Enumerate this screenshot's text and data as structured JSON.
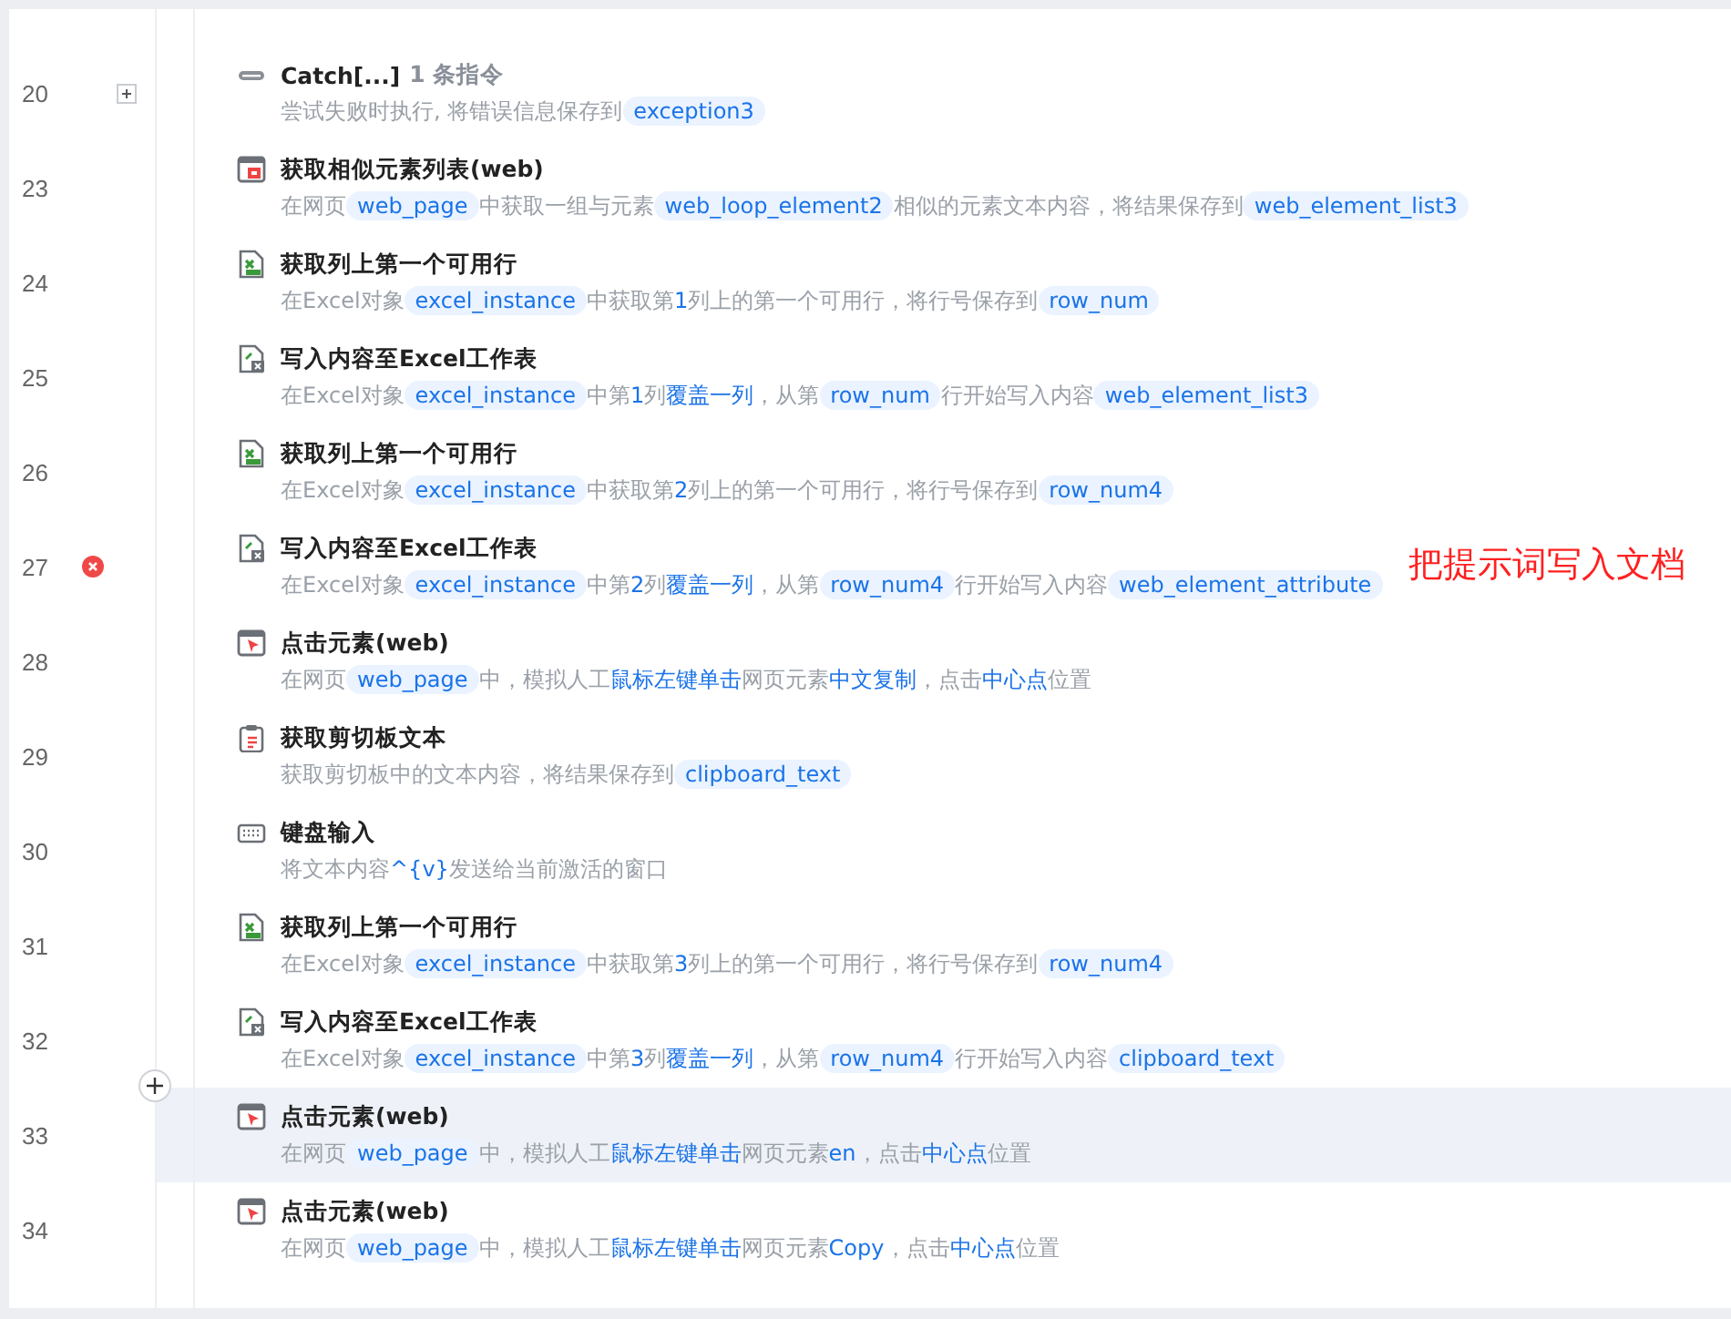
{
  "steps": [
    {
      "line": "20",
      "kind": "catch",
      "collapsed": true,
      "error": false,
      "highlighted": false,
      "title": "Catch[...]",
      "count": "1 条指令",
      "desc": [
        {
          "kind": "text",
          "text": "尝试失败时执行, 将错误信息保存到"
        },
        {
          "kind": "var",
          "text": "exception3"
        }
      ]
    },
    {
      "line": "23",
      "kind": "web-list",
      "error": false,
      "highlighted": false,
      "title": "获取相似元素列表(web)",
      "desc": [
        {
          "kind": "text",
          "text": "在网页"
        },
        {
          "kind": "var",
          "text": "web_page"
        },
        {
          "kind": "text",
          "text": "中获取一组与元素"
        },
        {
          "kind": "var",
          "text": "web_loop_element2"
        },
        {
          "kind": "text",
          "text": "相似的元素文本内容，将结果保存到"
        },
        {
          "kind": "var",
          "text": "web_element_list3"
        }
      ]
    },
    {
      "line": "24",
      "kind": "excel-read",
      "error": false,
      "highlighted": false,
      "title": "获取列上第一个可用行",
      "desc": [
        {
          "kind": "text",
          "text": "在Excel对象"
        },
        {
          "kind": "var",
          "text": "excel_instance"
        },
        {
          "kind": "text",
          "text": "中获取第"
        },
        {
          "kind": "kw",
          "text": "1"
        },
        {
          "kind": "text",
          "text": "列上的第一个可用行，将行号保存到"
        },
        {
          "kind": "var",
          "text": "row_num"
        }
      ]
    },
    {
      "line": "25",
      "kind": "excel-write",
      "error": false,
      "highlighted": false,
      "title": "写入内容至Excel工作表",
      "desc": [
        {
          "kind": "text",
          "text": "在Excel对象"
        },
        {
          "kind": "var",
          "text": "excel_instance"
        },
        {
          "kind": "text",
          "text": "中第"
        },
        {
          "kind": "kw",
          "text": "1"
        },
        {
          "kind": "text",
          "text": "列"
        },
        {
          "kind": "kw",
          "text": "覆盖一列"
        },
        {
          "kind": "text",
          "text": "，从第"
        },
        {
          "kind": "var",
          "text": "row_num"
        },
        {
          "kind": "text",
          "text": "行开始写入内容"
        },
        {
          "kind": "var",
          "text": "web_element_list3"
        }
      ]
    },
    {
      "line": "26",
      "kind": "excel-read",
      "error": false,
      "highlighted": false,
      "title": "获取列上第一个可用行",
      "desc": [
        {
          "kind": "text",
          "text": "在Excel对象"
        },
        {
          "kind": "var",
          "text": "excel_instance"
        },
        {
          "kind": "text",
          "text": "中获取第"
        },
        {
          "kind": "kw",
          "text": "2"
        },
        {
          "kind": "text",
          "text": "列上的第一个可用行，将行号保存到"
        },
        {
          "kind": "var",
          "text": "row_num4"
        }
      ]
    },
    {
      "line": "27",
      "kind": "excel-write",
      "error": true,
      "highlighted": false,
      "title": "写入内容至Excel工作表",
      "annotation": "把提示词写入文档",
      "desc": [
        {
          "kind": "text",
          "text": "在Excel对象"
        },
        {
          "kind": "var",
          "text": "excel_instance"
        },
        {
          "kind": "text",
          "text": "中第"
        },
        {
          "kind": "kw",
          "text": "2"
        },
        {
          "kind": "text",
          "text": "列"
        },
        {
          "kind": "kw",
          "text": "覆盖一列"
        },
        {
          "kind": "text",
          "text": "，从第"
        },
        {
          "kind": "var",
          "text": "row_num4"
        },
        {
          "kind": "text",
          "text": "行开始写入内容"
        },
        {
          "kind": "var",
          "text": "web_element_attribute"
        }
      ]
    },
    {
      "line": "28",
      "kind": "web-click",
      "error": false,
      "highlighted": false,
      "title": "点击元素(web)",
      "desc": [
        {
          "kind": "text",
          "text": "在网页"
        },
        {
          "kind": "var",
          "text": "web_page"
        },
        {
          "kind": "text",
          "text": "中，模拟人工"
        },
        {
          "kind": "kw",
          "text": "鼠标左键单击"
        },
        {
          "kind": "text",
          "text": "网页元素"
        },
        {
          "kind": "kw",
          "text": "中文复制"
        },
        {
          "kind": "text",
          "text": "，点击"
        },
        {
          "kind": "kw",
          "text": "中心点"
        },
        {
          "kind": "text",
          "text": "位置"
        }
      ]
    },
    {
      "line": "29",
      "kind": "clipboard",
      "error": false,
      "highlighted": false,
      "title": "获取剪切板文本",
      "desc": [
        {
          "kind": "text",
          "text": "获取剪切板中的文本内容，将结果保存到"
        },
        {
          "kind": "var",
          "text": "clipboard_text"
        }
      ]
    },
    {
      "line": "30",
      "kind": "keyboard",
      "error": false,
      "highlighted": false,
      "title": "键盘输入",
      "desc": [
        {
          "kind": "text",
          "text": "将文本内容"
        },
        {
          "kind": "kw",
          "text": "^{v}"
        },
        {
          "kind": "text",
          "text": "发送给当前激活的窗口"
        }
      ]
    },
    {
      "line": "31",
      "kind": "excel-read",
      "error": false,
      "highlighted": false,
      "title": "获取列上第一个可用行",
      "desc": [
        {
          "kind": "text",
          "text": "在Excel对象"
        },
        {
          "kind": "var",
          "text": "excel_instance"
        },
        {
          "kind": "text",
          "text": "中获取第"
        },
        {
          "kind": "kw",
          "text": "3"
        },
        {
          "kind": "text",
          "text": "列上的第一个可用行，将行号保存到"
        },
        {
          "kind": "var",
          "text": "row_num4"
        }
      ]
    },
    {
      "line": "32",
      "kind": "excel-write",
      "error": false,
      "highlighted": false,
      "title": "写入内容至Excel工作表",
      "desc": [
        {
          "kind": "text",
          "text": "在Excel对象"
        },
        {
          "kind": "var",
          "text": "excel_instance"
        },
        {
          "kind": "text",
          "text": "中第"
        },
        {
          "kind": "kw",
          "text": "3"
        },
        {
          "kind": "text",
          "text": "列"
        },
        {
          "kind": "kw",
          "text": "覆盖一列"
        },
        {
          "kind": "text",
          "text": "，从第"
        },
        {
          "kind": "var",
          "text": "row_num4"
        },
        {
          "kind": "text",
          "text": "行开始写入内容"
        },
        {
          "kind": "var",
          "text": "clipboard_text"
        }
      ]
    },
    {
      "line": "33",
      "kind": "web-click",
      "error": false,
      "highlighted": true,
      "insert_button": true,
      "title": "点击元素(web)",
      "desc": [
        {
          "kind": "text",
          "text": "在网页"
        },
        {
          "kind": "var",
          "text": "web_page"
        },
        {
          "kind": "text",
          "text": "中，模拟人工"
        },
        {
          "kind": "kw",
          "text": "鼠标左键单击"
        },
        {
          "kind": "text",
          "text": "网页元素"
        },
        {
          "kind": "kw",
          "text": "en"
        },
        {
          "kind": "text",
          "text": "，点击"
        },
        {
          "kind": "kw",
          "text": "中心点"
        },
        {
          "kind": "text",
          "text": "位置"
        }
      ]
    },
    {
      "line": "34",
      "kind": "web-click",
      "error": false,
      "highlighted": false,
      "title": "点击元素(web)",
      "desc": [
        {
          "kind": "text",
          "text": "在网页"
        },
        {
          "kind": "var",
          "text": "web_page"
        },
        {
          "kind": "text",
          "text": "中，模拟人工"
        },
        {
          "kind": "kw",
          "text": "鼠标左键单击"
        },
        {
          "kind": "text",
          "text": "网页元素"
        },
        {
          "kind": "kw",
          "text": "Copy"
        },
        {
          "kind": "text",
          "text": "，点击"
        },
        {
          "kind": "kw",
          "text": "中心点"
        },
        {
          "kind": "text",
          "text": "位置"
        }
      ]
    }
  ]
}
